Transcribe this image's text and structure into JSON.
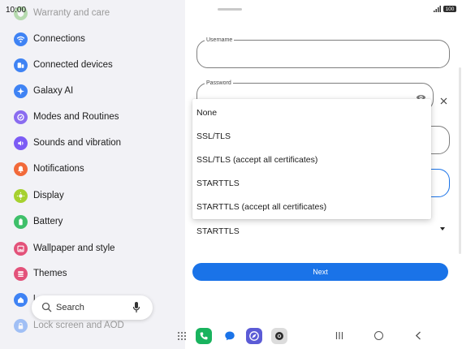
{
  "status": {
    "time": "10:00",
    "battery": "100"
  },
  "settings": {
    "items": [
      {
        "label": "Warranty and care",
        "icon": "warranty-icon",
        "color": "#6fbf5a",
        "faded": true
      },
      {
        "label": "Connections",
        "icon": "wifi-icon",
        "color": "#3f83f4"
      },
      {
        "label": "Connected devices",
        "icon": "devices-icon",
        "color": "#3f83f4"
      },
      {
        "label": "Galaxy AI",
        "icon": "galaxy-ai-icon",
        "color": "#3f83f4"
      },
      {
        "label": "Modes and Routines",
        "icon": "modes-icon",
        "color": "#8a6cf0"
      },
      {
        "label": "Sounds and vibration",
        "icon": "sound-icon",
        "color": "#7c5cf5"
      },
      {
        "label": "Notifications",
        "icon": "notifications-icon",
        "color": "#f26a3a"
      },
      {
        "label": "Display",
        "icon": "display-icon",
        "color": "#a6d12f"
      },
      {
        "label": "Battery",
        "icon": "battery-icon",
        "color": "#3fc06a"
      },
      {
        "label": "Wallpaper and style",
        "icon": "wallpaper-icon",
        "color": "#e3527a"
      },
      {
        "label": "Themes",
        "icon": "themes-icon",
        "color": "#e3527a"
      },
      {
        "label": "l",
        "icon": "home-screen-icon",
        "color": "#3f83f4"
      },
      {
        "label": "Lock screen and AOD",
        "icon": "lock-icon",
        "color": "#3f83f4",
        "faded": true
      }
    ]
  },
  "search": {
    "label": "Search"
  },
  "form": {
    "username_label": "Username",
    "password_label": "Password",
    "security_selected": "STARTTLS",
    "next_label": "Next"
  },
  "dropdown": {
    "options": [
      "None",
      "SSL/TLS",
      "SSL/TLS (accept all certificates)",
      "STARTTLS",
      "STARTTLS (accept all certificates)"
    ]
  },
  "taskbar": {
    "apps": [
      {
        "name": "phone-app-icon"
      },
      {
        "name": "messages-app-icon"
      },
      {
        "name": "browser-app-icon"
      },
      {
        "name": "camera-app-icon"
      }
    ]
  },
  "colors": {
    "accent": "#1a73e8"
  }
}
